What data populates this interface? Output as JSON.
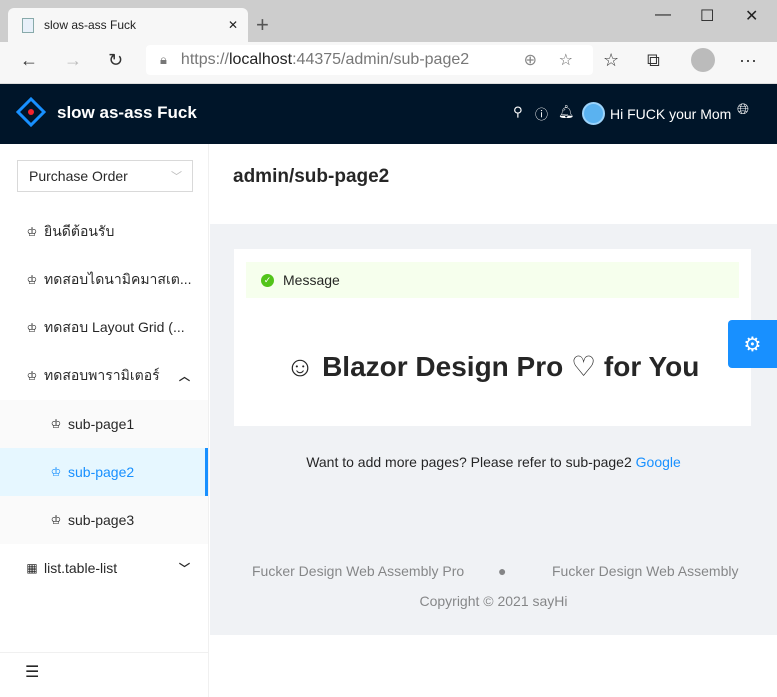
{
  "browser": {
    "tab_title": "slow as-ass Fuck",
    "new_tab": "+",
    "url_prefix": "https://",
    "url_host": "localhost",
    "url_rest": ":44375/admin/sub-page2",
    "minimize": "—",
    "maximize": "☐",
    "close": "✕"
  },
  "header": {
    "brand": "slow as-ass Fuck",
    "user": "Hi FUCK your Mom"
  },
  "sidebar": {
    "select_value": "Purchase Order",
    "items": [
      {
        "label": "ยินดีต้อนรับ"
      },
      {
        "label": "ทดสอบไดนามิคมาสเต..."
      },
      {
        "label": "ทดสอบ Layout Grid (..."
      },
      {
        "label": "ทดสอบพารามิเตอร์"
      },
      {
        "label": "sub-page1"
      },
      {
        "label": "sub-page2"
      },
      {
        "label": "sub-page3"
      },
      {
        "label": "list.table-list"
      }
    ]
  },
  "page": {
    "title": "admin/sub-page2",
    "alert": "Message",
    "heading": "☺ Blazor Design Pro ♡ for You",
    "more_text": "Want to add more pages? Please refer to sub-page2",
    "more_link": "Google"
  },
  "footer": {
    "link1": "Fucker Design Web Assembly Pro",
    "link2": "Fucker Design Web Assembly",
    "copyright": "Copyright © 2021 sayHi"
  },
  "colors": {
    "primary": "#1890ff",
    "header_bg": "#001529",
    "success": "#52c41a"
  }
}
